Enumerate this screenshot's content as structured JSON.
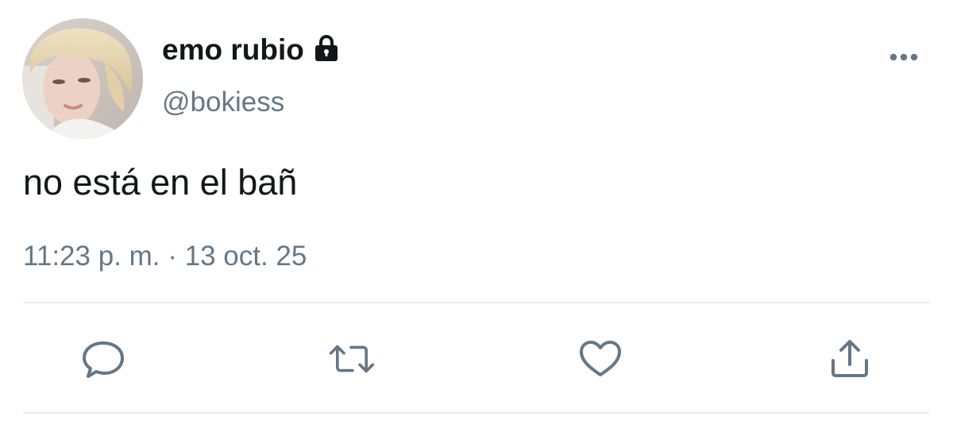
{
  "tweet": {
    "display_name": "emo rubio",
    "handle": "@bokiess",
    "text": "no está en el bañ",
    "timestamp": "11:23 p. m. · 13 oct. 25",
    "protected": true
  },
  "icons": {
    "avatar": "avatar-photo",
    "lock": "lock-icon",
    "more": "more-options-icon",
    "reply": "reply-icon",
    "retweet": "retweet-icon",
    "like": "like-icon",
    "share": "share-icon"
  },
  "colors": {
    "text_primary": "#14171a",
    "text_secondary": "#657786",
    "divider": "#e6ecf0"
  }
}
